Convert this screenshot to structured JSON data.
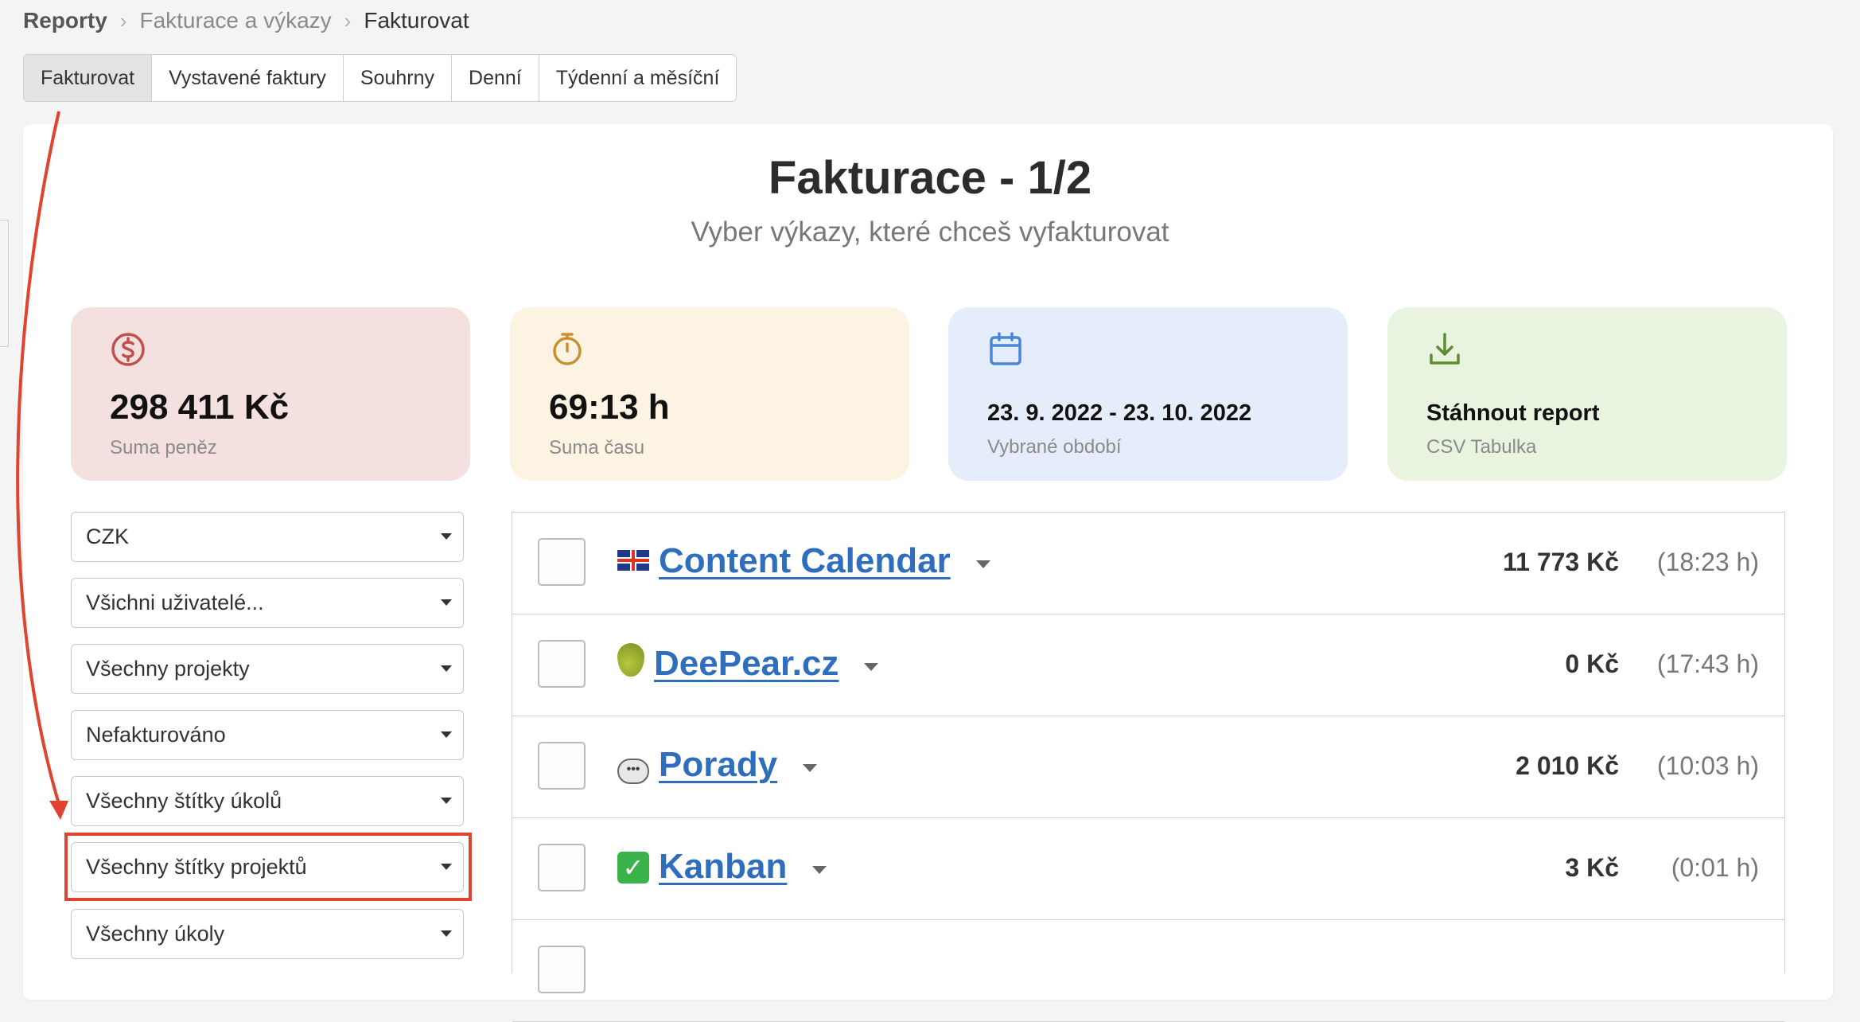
{
  "breadcrumb": {
    "root": "Reporty",
    "section": "Fakturace a výkazy",
    "current": "Fakturovat"
  },
  "tabs": [
    "Fakturovat",
    "Vystavené faktury",
    "Souhrny",
    "Denní",
    "Týdenní a měsíční"
  ],
  "header": {
    "title": "Fakturace - 1/2",
    "subtitle": "Vyber výkazy, které chceš vyfakturovat"
  },
  "cards": {
    "money": {
      "value": "298 411 Kč",
      "label": "Suma peněz",
      "icon": "dollar-circle-icon",
      "color": "#c0504d"
    },
    "time": {
      "value": "69:13 h",
      "label": "Suma času",
      "icon": "stopwatch-icon",
      "color": "#c8902e"
    },
    "period": {
      "value": "23. 9. 2022 - 23. 10. 2022",
      "label": "Vybrané období",
      "icon": "calendar-icon",
      "color": "#4a86d6"
    },
    "download": {
      "value": "Stáhnout report",
      "label": "CSV Tabulka",
      "icon": "download-icon",
      "color": "#5e8c2f"
    }
  },
  "filters": [
    "CZK",
    "Všichni uživatelé...",
    "Všechny projekty",
    "Nefakturováno",
    "Všechny štítky úkolů",
    "Všechny štítky projektů",
    "Všechny úkoly"
  ],
  "projects": [
    {
      "icon": "uk-flag-icon",
      "name": "Content Calendar",
      "amount": "11 773 Kč",
      "hours": "(18:23 h)"
    },
    {
      "icon": "pear-icon",
      "name": "DeePear.cz",
      "amount": "0 Kč",
      "hours": "(17:43 h)"
    },
    {
      "icon": "speech-bubble-icon",
      "name": "Porady",
      "amount": "2 010 Kč",
      "hours": "(10:03 h)"
    },
    {
      "icon": "check-mark-icon",
      "name": "Kanban",
      "amount": "3 Kč",
      "hours": "(0:01 h)"
    }
  ]
}
